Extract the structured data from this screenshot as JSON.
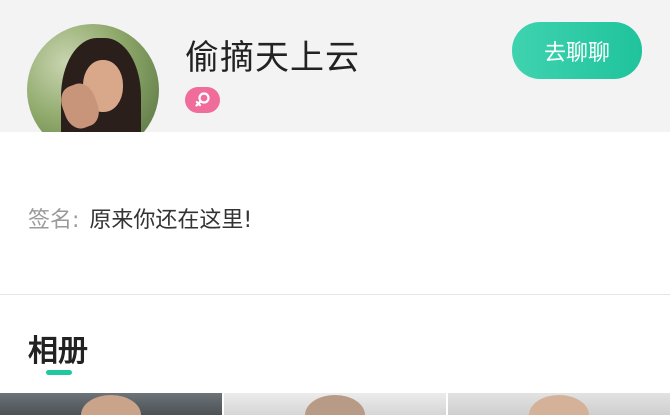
{
  "profile": {
    "username": "偷摘天上云",
    "chat_button": "去聊聊",
    "gender": "female-icon"
  },
  "signature": {
    "label": "签名:",
    "value": "原来你还在这里!"
  },
  "album": {
    "title": "相册",
    "photos": [
      "photo-1",
      "photo-2",
      "photo-3"
    ]
  },
  "colors": {
    "accent": "#21c7a0",
    "gender_badge": "#f06c9b",
    "header_bg": "#f3f3f3"
  }
}
